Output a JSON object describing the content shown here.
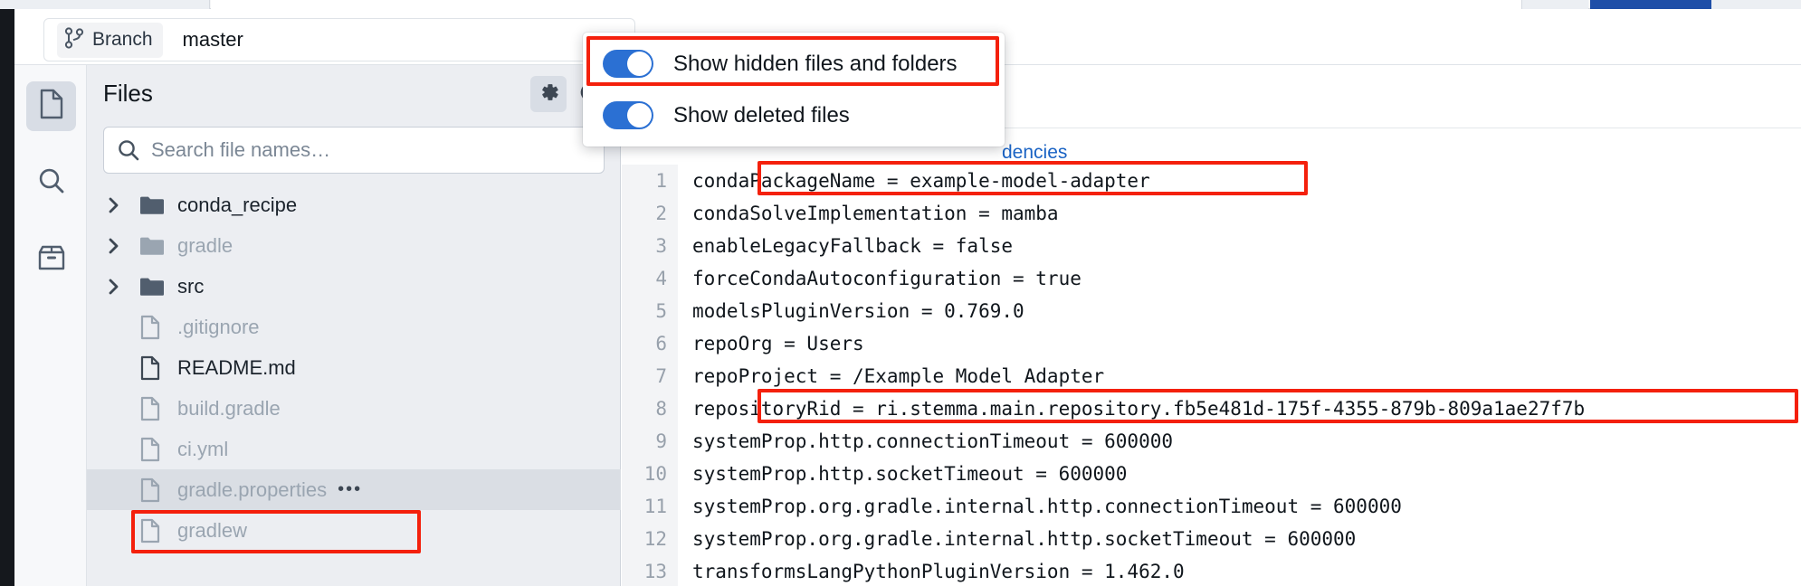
{
  "window": {
    "tabs_visible": true
  },
  "branch_bar": {
    "icon": "branch-icon",
    "chip_label": "Branch",
    "branch_name": "master"
  },
  "rail": {
    "items": [
      {
        "icon": "document-icon",
        "name": "files",
        "active": true
      },
      {
        "icon": "search-icon",
        "name": "search",
        "active": false
      },
      {
        "icon": "archive-box-icon",
        "name": "artifacts",
        "active": false
      }
    ]
  },
  "files_panel": {
    "title": "Files",
    "settings_icon": "gear-icon",
    "refresh_icon": "refresh-icon",
    "search": {
      "placeholder": "Search file names…",
      "value": "",
      "icon": "search-icon"
    },
    "tree": [
      {
        "name": "conda_recipe",
        "type": "folder",
        "expandable": true,
        "dim": false,
        "selected": false
      },
      {
        "name": "gradle",
        "type": "folder",
        "expandable": true,
        "dim": true,
        "selected": false
      },
      {
        "name": "src",
        "type": "folder",
        "expandable": true,
        "dim": false,
        "selected": false
      },
      {
        "name": ".gitignore",
        "type": "file",
        "expandable": false,
        "dim": true,
        "selected": false
      },
      {
        "name": "README.md",
        "type": "file",
        "expandable": false,
        "dim": false,
        "selected": false
      },
      {
        "name": "build.gradle",
        "type": "file",
        "expandable": false,
        "dim": true,
        "selected": false
      },
      {
        "name": "ci.yml",
        "type": "file",
        "expandable": false,
        "dim": true,
        "selected": false
      },
      {
        "name": "gradle.properties",
        "type": "file",
        "expandable": false,
        "dim": true,
        "selected": true,
        "overflow": "•••"
      },
      {
        "name": "gradlew",
        "type": "file",
        "expandable": false,
        "dim": true,
        "selected": false
      }
    ]
  },
  "editor": {
    "toolbar_icons": [
      "edit-pencil-icon",
      "add-branch-point-icon"
    ],
    "breadcrumb_link": "dencies",
    "lines": [
      {
        "n": "1",
        "text": "condaPackageName = example-model-adapter"
      },
      {
        "n": "2",
        "text": "condaSolveImplementation = mamba"
      },
      {
        "n": "3",
        "text": "enableLegacyFallback = false"
      },
      {
        "n": "4",
        "text": "forceCondaAutoconfiguration = true"
      },
      {
        "n": "5",
        "text": "modelsPluginVersion = 0.769.0"
      },
      {
        "n": "6",
        "text": "repoOrg = Users"
      },
      {
        "n": "7",
        "text": "repoProject = /Example Model Adapter"
      },
      {
        "n": "8",
        "text": "repositoryRid = ri.stemma.main.repository.fb5e481d-175f-4355-879b-809a1ae27f7b"
      },
      {
        "n": "9",
        "text": "systemProp.http.connectionTimeout = 600000"
      },
      {
        "n": "10",
        "text": "systemProp.http.socketTimeout = 600000"
      },
      {
        "n": "11",
        "text": "systemProp.org.gradle.internal.http.connectionTimeout = 600000"
      },
      {
        "n": "12",
        "text": "systemProp.org.gradle.internal.http.socketTimeout = 600000"
      },
      {
        "n": "13",
        "text": "transformsLangPythonPluginVersion = 1.462.0"
      }
    ]
  },
  "popup": {
    "items": [
      {
        "label": "Show hidden files and folders",
        "on": true
      },
      {
        "label": "Show deleted files",
        "on": true
      }
    ]
  },
  "annotations": {
    "color": "#f4200c",
    "boxes": [
      "show-hidden-files-toggle",
      "gradle-properties-row",
      "code-line-1",
      "code-line-8"
    ]
  }
}
